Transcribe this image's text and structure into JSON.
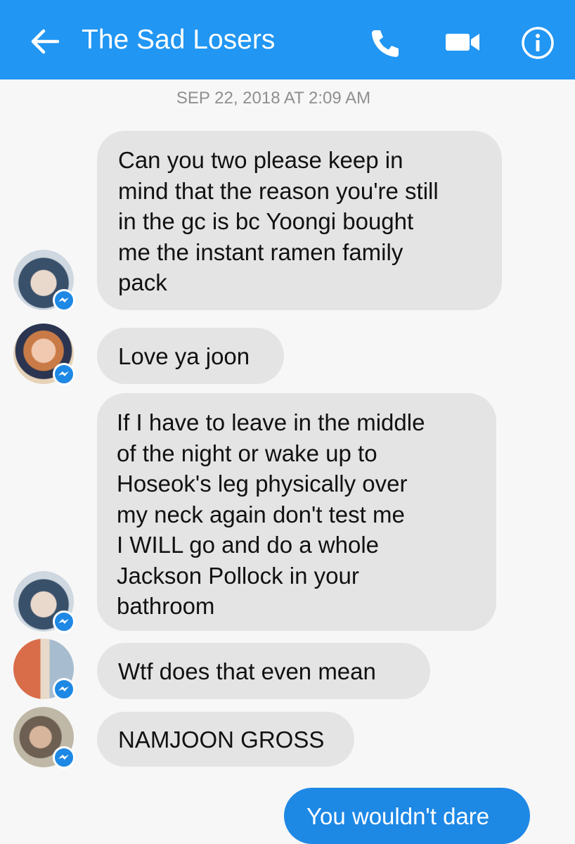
{
  "header": {
    "title": "The Sad Losers",
    "background": "#2196f3",
    "icons": [
      "back-arrow-icon",
      "phone-icon",
      "video-camera-icon",
      "info-icon"
    ]
  },
  "conversation": {
    "timestamp": "SEP 22, 2018 AT 2:09 AM",
    "messages": [
      {
        "text": "Can you two please keep in\nmind that the reason you're still\nin the gc is bc Yoongi bought\nme the instant ramen family\npack"
      },
      {
        "text": "Love ya joon"
      },
      {
        "text": "If I have to leave in the middle\nof the night or wake up to\nHoseok's leg physically over\nmy neck again don't test me\nI WILL go and do a whole\nJackson Pollock in your\nbathroom"
      },
      {
        "text": "Wtf does that even mean"
      },
      {
        "text": "NAMJOON GROSS"
      },
      {
        "text": "You wouldn't dare"
      }
    ]
  },
  "colors": {
    "incoming_bubble": "#e4e4e4",
    "outgoing_bubble": "#1e88e5",
    "background": "#f7f7f7"
  }
}
